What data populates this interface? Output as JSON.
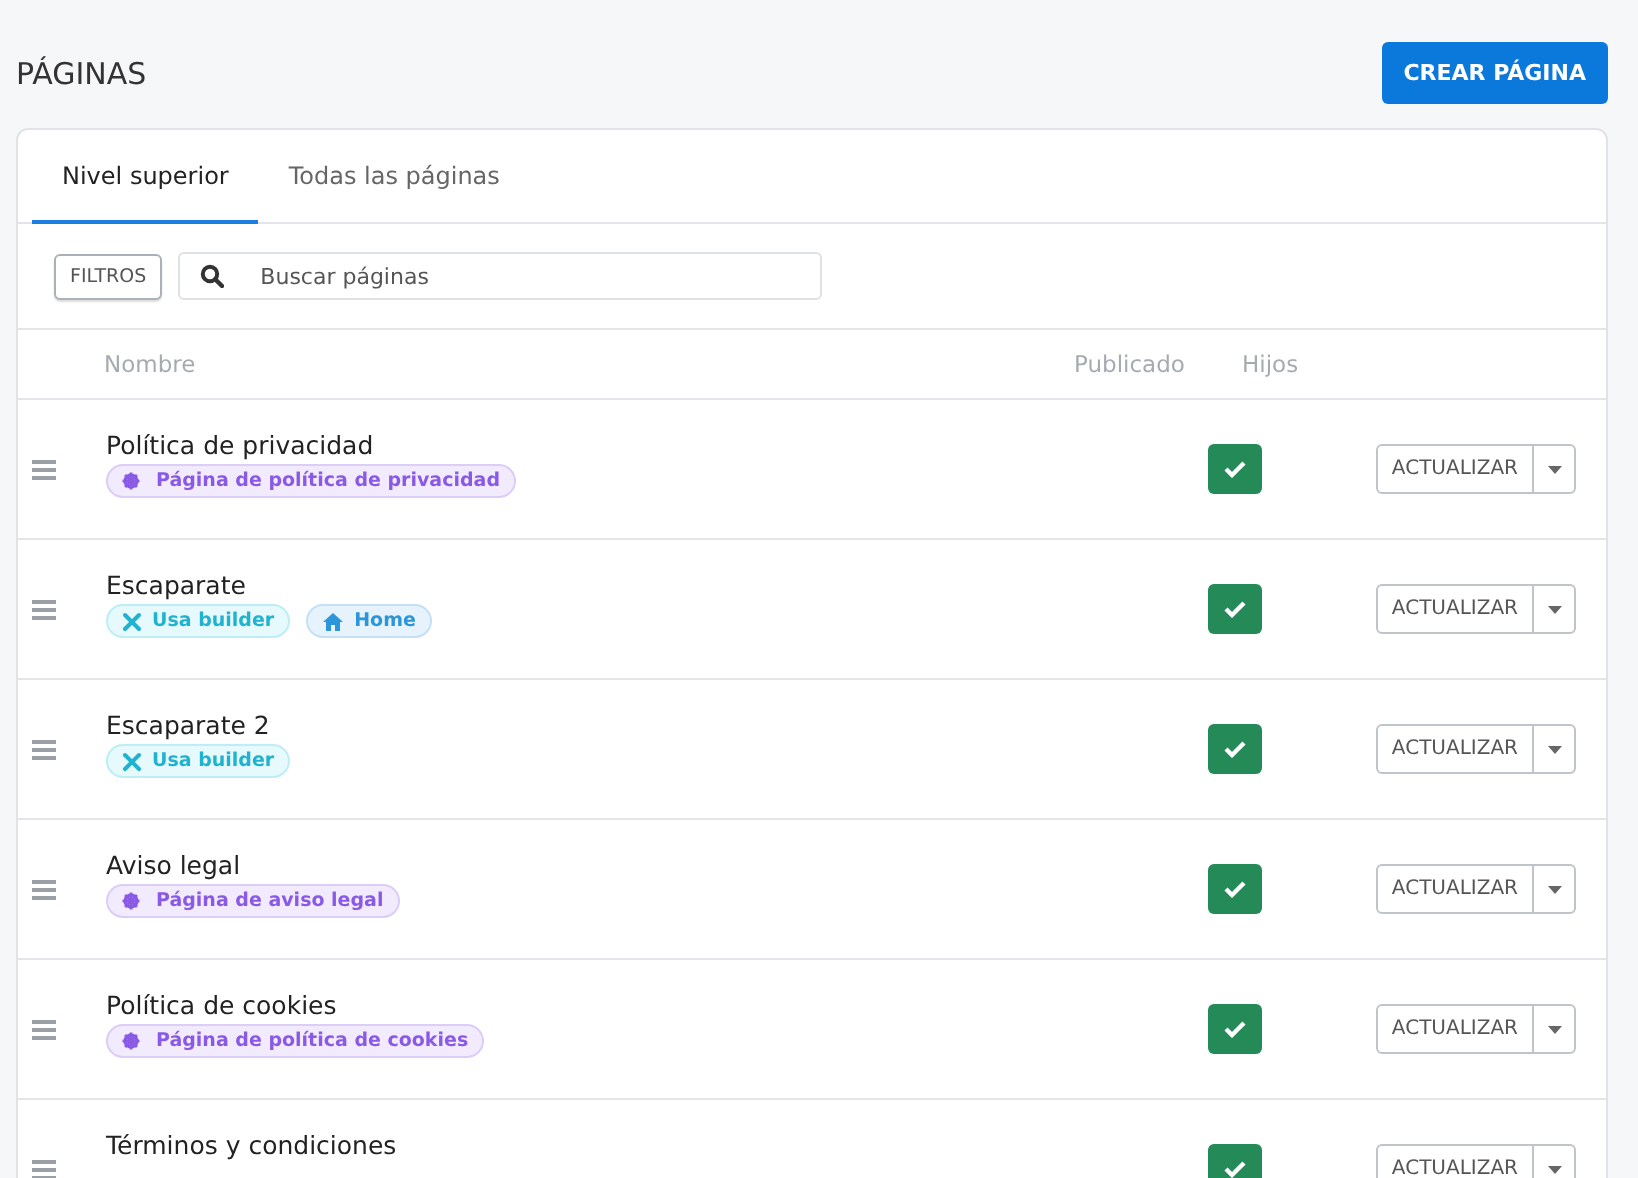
{
  "title": "PÁGINAS",
  "create_button": "CREAR PÁGINA",
  "tabs": [
    {
      "label": "Nivel superior",
      "selected": true
    },
    {
      "label": "Todas las páginas",
      "selected": false
    }
  ],
  "filters_button": "FILTROS",
  "search": {
    "placeholder": "Buscar páginas"
  },
  "table": {
    "columns": [
      "Nombre",
      "Publicado",
      "Hijos"
    ],
    "rows": [
      {
        "name": "Política de privacidad",
        "tags": [
          {
            "kind": "system",
            "label": "Página de política de privacidad"
          }
        ],
        "published": true,
        "action": "ACTUALIZAR"
      },
      {
        "name": "Escaparate",
        "tags": [
          {
            "kind": "builder",
            "label": "Usa builder"
          },
          {
            "kind": "home",
            "label": "Home"
          }
        ],
        "published": true,
        "action": "ACTUALIZAR"
      },
      {
        "name": "Escaparate 2",
        "tags": [
          {
            "kind": "builder",
            "label": "Usa builder"
          }
        ],
        "published": true,
        "action": "ACTUALIZAR"
      },
      {
        "name": "Aviso legal",
        "tags": [
          {
            "kind": "system",
            "label": "Página de aviso legal"
          }
        ],
        "published": true,
        "action": "ACTUALIZAR"
      },
      {
        "name": "Política de cookies",
        "tags": [
          {
            "kind": "system",
            "label": "Página de política de cookies"
          }
        ],
        "published": true,
        "action": "ACTUALIZAR"
      },
      {
        "name": "Términos y condiciones",
        "tags": [],
        "published": true,
        "action": "ACTUALIZAR"
      }
    ]
  }
}
